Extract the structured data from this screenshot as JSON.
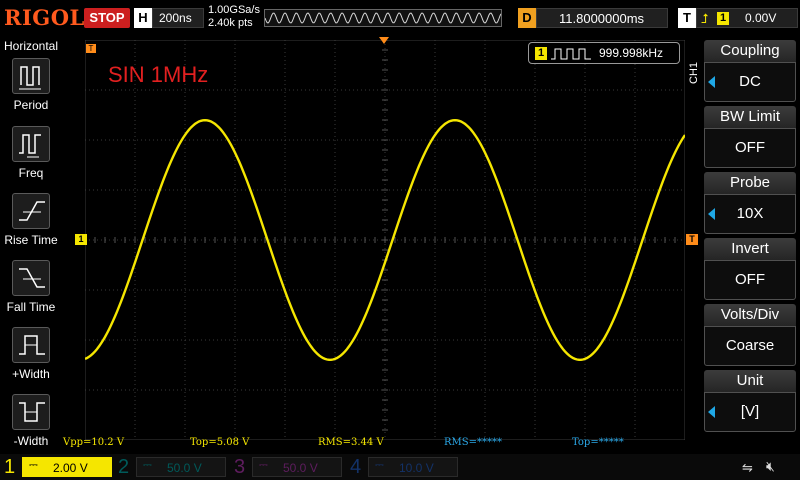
{
  "brand": "RIGOL",
  "status": "STOP",
  "horizontal": {
    "letter": "H",
    "timebase": "200ns",
    "sample_rate": "1.00GSa/s",
    "points": "2.40k pts"
  },
  "delay": {
    "letter": "D",
    "value": "11.8000000ms"
  },
  "trigger": {
    "letter": "T",
    "channel": "1",
    "level": "0.00V",
    "edge_icon": "rising-edge-icon"
  },
  "left_menu": {
    "title": "Horizontal",
    "items": [
      {
        "label": "Period",
        "icon": "period-icon"
      },
      {
        "label": "Freq",
        "icon": "freq-icon"
      },
      {
        "label": "Rise Time",
        "icon": "rise-time-icon"
      },
      {
        "label": "Fall Time",
        "icon": "fall-time-icon"
      },
      {
        "label": "+Width",
        "icon": "pos-width-icon"
      },
      {
        "label": "-Width",
        "icon": "neg-width-icon"
      }
    ]
  },
  "right_menu": {
    "channel_tag": "CH1",
    "items": [
      {
        "title": "Coupling",
        "value": "DC"
      },
      {
        "title": "BW Limit",
        "value": "OFF"
      },
      {
        "title": "Probe",
        "value": "10X"
      },
      {
        "title": "Invert",
        "value": "OFF"
      },
      {
        "title": "Volts/Div",
        "value": "Coarse"
      },
      {
        "title": "Unit",
        "value": "[V]"
      }
    ]
  },
  "annotation": "SIN 1MHz",
  "frequency_counter": {
    "channel": "1",
    "value": "999.998kHz"
  },
  "measurements": [
    "Vpp=10.2 V",
    "Top=5.08 V",
    "RMS=3.44 V",
    "RMS=*****",
    "Top=*****"
  ],
  "channels": [
    {
      "num": "1",
      "scale": "2.00 V",
      "color": "#f5e600",
      "active": true
    },
    {
      "num": "2",
      "scale": "50.0 V",
      "color": "#00c8c8",
      "active": false
    },
    {
      "num": "3",
      "scale": "50.0 V",
      "color": "#d040d0",
      "active": false
    },
    {
      "num": "4",
      "scale": "10.0 V",
      "color": "#2a6ee8",
      "active": false
    }
  ],
  "colors": {
    "trace": "#f5e600",
    "marker": "#ff8c1a",
    "accent": "#1fa8e6",
    "stop": "#cc1f1f",
    "brand": "#ff5a1e"
  },
  "chart_data": {
    "type": "line",
    "series": [
      {
        "values_note_free": true,
        "x_ns": [
          0,
          250,
          500,
          750,
          1000,
          1250,
          1500,
          1750,
          2000
        ],
        "y_div": [
          -2.25,
          2.1
        ]
      }
    ],
    "frequency_mhz": 1,
    "vpp_v": 10.2,
    "top_v": 5.08,
    "volts_per_div": 2.0,
    "time_per_div_ns": 200,
    "grid": true
  }
}
